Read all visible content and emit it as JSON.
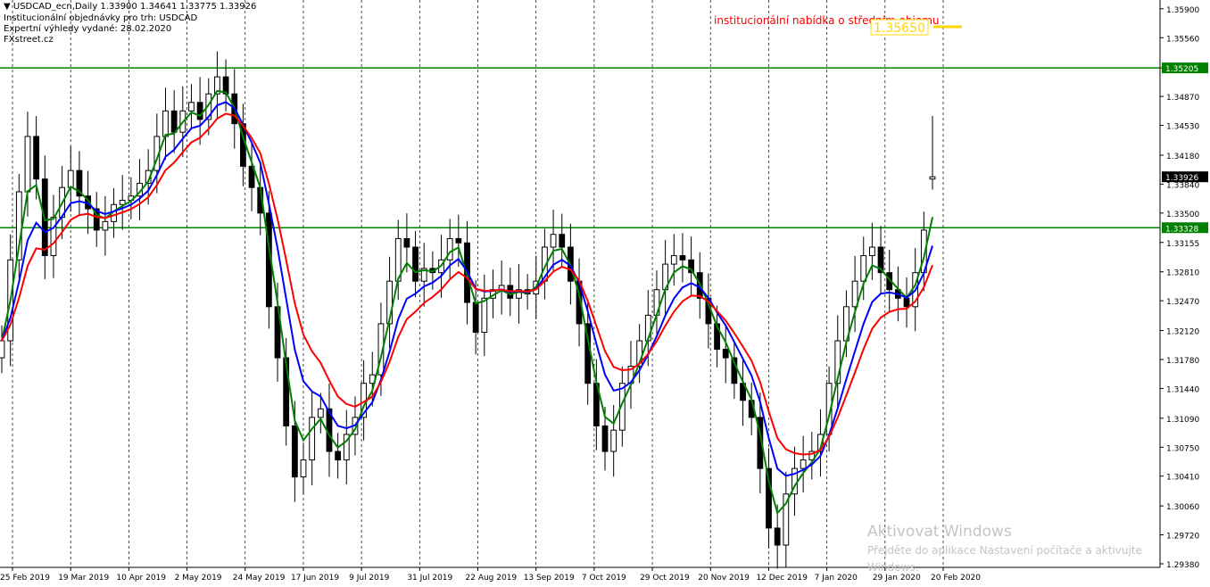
{
  "header": {
    "symbol_line": "USDCAD_ecn,Daily  1.33900 1.34641 1.33775 1.33926",
    "line2": "Institucionální objednávky pro trh: USDCAD",
    "line3": "Expertní výhledy vydané: 28.02.2020",
    "line4": "FXstreet.cz"
  },
  "annotation": {
    "text": "institucionální nabídka o středním objemu",
    "price_label": "1.35650"
  },
  "watermark": {
    "line1": "Aktivovat Windows",
    "line2": "Přejděte do aplikace Nastavení počítače a aktivujte",
    "line3": "Windows."
  },
  "colors": {
    "bull_body": "#ffffff",
    "bear_body": "#000000",
    "ma_fast": "#008000",
    "ma_mid": "#0000ff",
    "ma_slow": "#ff0000",
    "level_line": "#008000",
    "annotation": "#ff0000",
    "price_tag": "#ffd700"
  },
  "chart_data": {
    "type": "candlestick",
    "symbol": "USDCAD_ecn",
    "timeframe": "Daily",
    "y_range": [
      1.2938,
      1.3594
    ],
    "y_ticks": [
      "1.35900",
      "1.35560",
      "1.35205",
      "1.34870",
      "1.34530",
      "1.34180",
      "1.33840",
      "1.33500",
      "1.33155",
      "1.32810",
      "1.32470",
      "1.32120",
      "1.31780",
      "1.31440",
      "1.31090",
      "1.30750",
      "1.30410",
      "1.30060",
      "1.29720",
      "1.29380"
    ],
    "x_labels": [
      "25 Feb 2019",
      "19 Mar 2019",
      "10 Apr 2019",
      "2 May 2019",
      "24 May 2019",
      "17 Jun 2019",
      "9 Jul 2019",
      "31 Jul 2019",
      "22 Aug 2019",
      "13 Sep 2019",
      "7 Oct 2019",
      "29 Oct 2019",
      "20 Nov 2019",
      "12 Dec 2019",
      "7 Jan 2020",
      "29 Jan 2020",
      "20 Feb 2020"
    ],
    "levels": [
      {
        "price": 1.35205,
        "label": "1.35205"
      },
      {
        "price": 1.33328,
        "label": "1.33328"
      }
    ],
    "target_price": 1.3565,
    "current_price": {
      "price": 1.33926,
      "label": "1.33926"
    },
    "last_bar": {
      "open": 1.339,
      "high": 1.34641,
      "low": 1.33775,
      "close": 1.33926
    },
    "closes": [
      1.32,
      1.3295,
      1.3375,
      1.344,
      1.339,
      1.33,
      1.3345,
      1.338,
      1.34,
      1.337,
      1.3355,
      1.333,
      1.334,
      1.336,
      1.3365,
      1.337,
      1.3385,
      1.34,
      1.344,
      1.347,
      1.3445,
      1.347,
      1.348,
      1.346,
      1.349,
      1.351,
      1.349,
      1.3455,
      1.3405,
      1.338,
      1.335,
      1.324,
      1.318,
      1.31,
      1.304,
      1.306,
      1.311,
      1.312,
      1.307,
      1.306,
      1.309,
      1.311,
      1.315,
      1.316,
      1.322,
      1.327,
      1.332,
      1.331,
      1.327,
      1.3285,
      1.328,
      1.3295,
      1.332,
      1.3315,
      1.3245,
      1.321,
      1.325,
      1.326,
      1.3265,
      1.325,
      1.326,
      1.3255,
      1.327,
      1.331,
      1.3325,
      1.331,
      1.327,
      1.322,
      1.315,
      1.31,
      1.307,
      1.3095,
      1.315,
      1.317,
      1.32,
      1.323,
      1.326,
      1.329,
      1.33,
      1.3295,
      1.328,
      1.325,
      1.322,
      1.319,
      1.318,
      1.315,
      1.313,
      1.311,
      1.305,
      1.298,
      1.296,
      1.302,
      1.305,
      1.306,
      1.307,
      1.309,
      1.315,
      1.32,
      1.324,
      1.327,
      1.33,
      1.331,
      1.328,
      1.326,
      1.325,
      1.324,
      1.328,
      1.333,
      1.33926
    ]
  }
}
